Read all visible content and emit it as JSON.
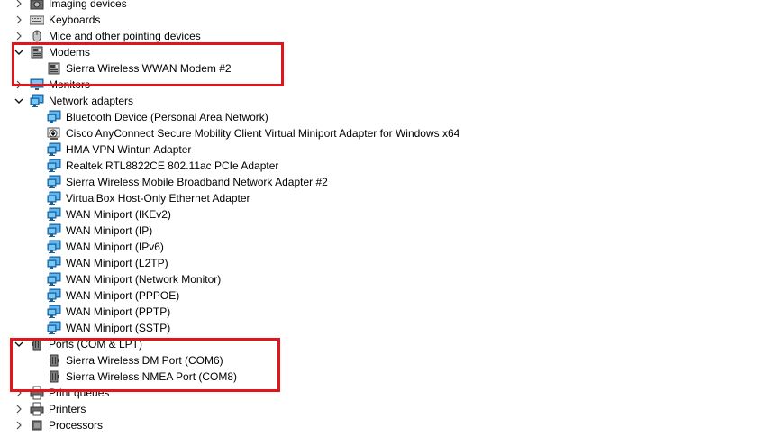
{
  "tree": [
    {
      "type": "cat",
      "label": "Imaging devices",
      "icon": "imaging-icon",
      "expanded": false
    },
    {
      "type": "cat",
      "label": "Keyboards",
      "icon": "keyboard-icon",
      "expanded": false
    },
    {
      "type": "cat",
      "label": "Mice and other pointing devices",
      "icon": "mouse-icon",
      "expanded": false
    },
    {
      "type": "cat",
      "label": "Modems",
      "icon": "modem-icon",
      "expanded": true
    },
    {
      "type": "child",
      "label": "Sierra Wireless WWAN Modem #2",
      "icon": "modem-icon"
    },
    {
      "type": "cat",
      "label": "Monitors",
      "icon": "monitor-icon",
      "expanded": false
    },
    {
      "type": "cat",
      "label": "Network adapters",
      "icon": "network-adapter-icon",
      "expanded": true
    },
    {
      "type": "child",
      "label": "Bluetooth Device (Personal Area Network)",
      "icon": "network-adapter-icon"
    },
    {
      "type": "child",
      "label": "Cisco AnyConnect Secure Mobility Client Virtual Miniport Adapter for Windows x64",
      "icon": "network-adapter-disabled-icon"
    },
    {
      "type": "child",
      "label": "HMA VPN Wintun Adapter",
      "icon": "network-adapter-icon"
    },
    {
      "type": "child",
      "label": "Realtek RTL8822CE 802.11ac PCIe Adapter",
      "icon": "network-adapter-icon"
    },
    {
      "type": "child",
      "label": "Sierra Wireless Mobile Broadband Network Adapter #2",
      "icon": "network-adapter-icon"
    },
    {
      "type": "child",
      "label": "VirtualBox Host-Only Ethernet Adapter",
      "icon": "network-adapter-icon"
    },
    {
      "type": "child",
      "label": "WAN Miniport (IKEv2)",
      "icon": "network-adapter-icon"
    },
    {
      "type": "child",
      "label": "WAN Miniport (IP)",
      "icon": "network-adapter-icon"
    },
    {
      "type": "child",
      "label": "WAN Miniport (IPv6)",
      "icon": "network-adapter-icon"
    },
    {
      "type": "child",
      "label": "WAN Miniport (L2TP)",
      "icon": "network-adapter-icon"
    },
    {
      "type": "child",
      "label": "WAN Miniport (Network Monitor)",
      "icon": "network-adapter-icon"
    },
    {
      "type": "child",
      "label": "WAN Miniport (PPPOE)",
      "icon": "network-adapter-icon"
    },
    {
      "type": "child",
      "label": "WAN Miniport (PPTP)",
      "icon": "network-adapter-icon"
    },
    {
      "type": "child",
      "label": "WAN Miniport (SSTP)",
      "icon": "network-adapter-icon"
    },
    {
      "type": "cat",
      "label": "Ports (COM & LPT)",
      "icon": "port-icon",
      "expanded": true
    },
    {
      "type": "child",
      "label": "Sierra Wireless DM Port (COM6)",
      "icon": "port-icon"
    },
    {
      "type": "child",
      "label": "Sierra Wireless NMEA Port (COM8)",
      "icon": "port-icon"
    },
    {
      "type": "cat",
      "label": "Print queues",
      "icon": "printer-icon",
      "expanded": false
    },
    {
      "type": "cat",
      "label": "Printers",
      "icon": "printer-icon",
      "expanded": false
    },
    {
      "type": "cat",
      "label": "Processors",
      "icon": "processor-icon",
      "expanded": false
    }
  ],
  "colors": {
    "highlight": "#e0161c",
    "monitor": "#2a8fd8",
    "chevron": "#4d4d4d"
  }
}
